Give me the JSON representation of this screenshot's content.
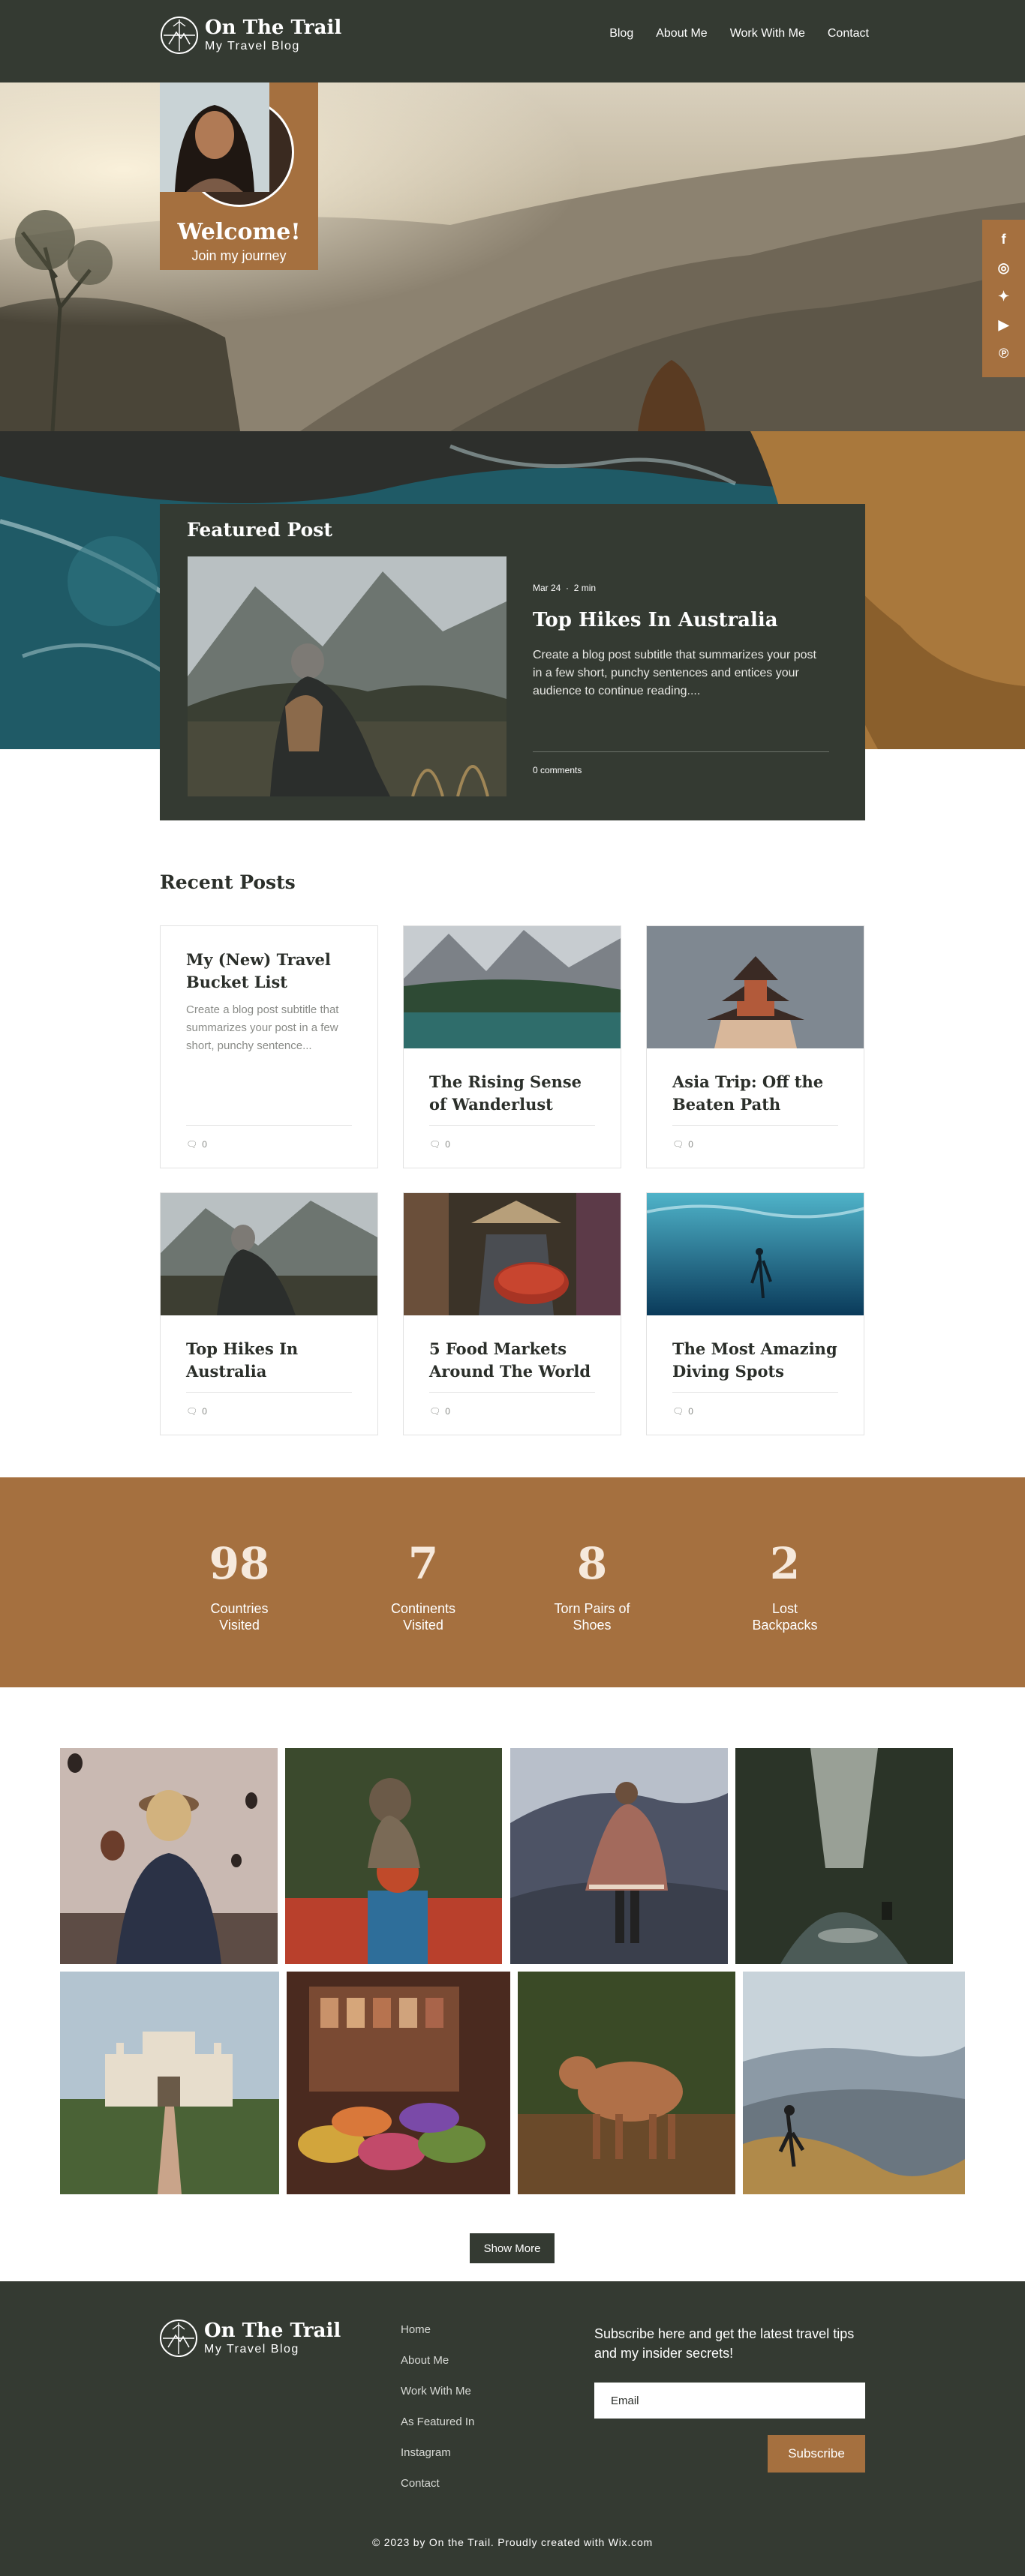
{
  "header": {
    "logo_title": "On The Trail",
    "logo_sub": "My Travel Blog",
    "nav": [
      "Blog",
      "About Me",
      "Work With Me",
      "Contact"
    ]
  },
  "hero": {
    "welcome_title": "Welcome!",
    "welcome_sub": "Join my journey",
    "social_icons": [
      "facebook-icon",
      "instagram-icon",
      "twitter-icon",
      "youtube-icon",
      "pinterest-icon"
    ]
  },
  "featured": {
    "label": "Featured Post",
    "date": "Mar 24",
    "read_time": "2 min",
    "title": "Top Hikes In Australia",
    "excerpt": "Create a blog post subtitle that summarizes your post in a few short, punchy sentences and entices your audience to continue reading....",
    "comments": "0 comments"
  },
  "recent": {
    "title": "Recent Posts",
    "posts": [
      {
        "title": "My (New) Travel Bucket List",
        "excerpt": "Create a blog post subtitle that summarizes your post in a few short, punchy sentence...",
        "comments": "0"
      },
      {
        "title": "The Rising Sense of Wanderlust",
        "comments": "0"
      },
      {
        "title": "Asia Trip: Off the Beaten Path",
        "comments": "0"
      },
      {
        "title": "Top Hikes In Australia",
        "comments": "0"
      },
      {
        "title": "5 Food Markets Around The World",
        "comments": "0"
      },
      {
        "title": "The Most Amazing Diving Spots",
        "comments": "0"
      }
    ]
  },
  "stats": [
    {
      "value": "98",
      "label": "Countries Visited"
    },
    {
      "value": "7",
      "label": "Continents Visited"
    },
    {
      "value": "8",
      "label": "Torn Pairs of Shoes"
    },
    {
      "value": "2",
      "label": "Lost Backpacks"
    }
  ],
  "gallery": {
    "show_more": "Show More"
  },
  "footer": {
    "logo_title": "On The Trail",
    "logo_sub": "My Travel Blog",
    "links": [
      "Home",
      "About Me",
      "Work With Me",
      "As Featured In",
      "Instagram",
      "Contact"
    ],
    "subscribe_text": "Subscribe here and get the latest travel tips and my insider secrets!",
    "email_placeholder": "Email",
    "subscribe_button": "Subscribe",
    "copyright": "© 2023 by On the Trail. Proudly created with Wix.com"
  },
  "colors": {
    "dark": "#343a32",
    "accent": "#a5703f"
  }
}
